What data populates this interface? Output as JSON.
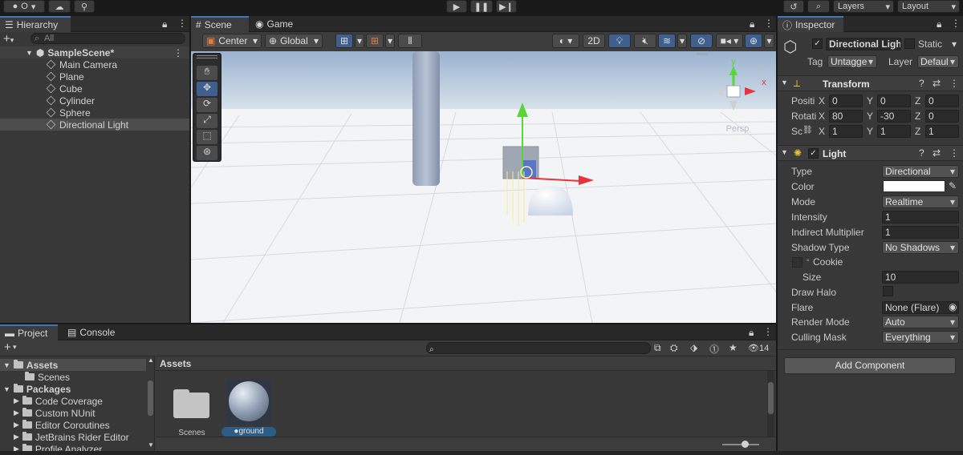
{
  "toolbar": {
    "account_label": "O",
    "play_icon": "play-icon",
    "pause_icon": "pause-icon",
    "step_icon": "step-icon",
    "layers_label": "Layers",
    "layout_label": "Layout"
  },
  "hierarchy": {
    "tab_label": "Hierarchy",
    "search_placeholder": "All",
    "scene_name": "SampleScene*",
    "items": [
      "Main Camera",
      "Plane",
      "Cube",
      "Cylinder",
      "Sphere",
      "Directional Light"
    ],
    "selected_index": 5
  },
  "scene": {
    "tabs": [
      "Scene",
      "Game"
    ],
    "pivot_label": "Center",
    "space_label": "Global",
    "mode_2d_label": "2D",
    "persp_label": "Persp",
    "gizmo_axis_y": "y",
    "gizmo_axis_x": "x"
  },
  "inspector": {
    "tab_label": "Inspector",
    "object_name": "Directional Ligh",
    "static_label": "Static",
    "tag_label": "Tag",
    "tag_value": "Untagge",
    "layer_label": "Layer",
    "layer_value": "Defaul",
    "transform": {
      "title": "Transform",
      "position_label": "Positi",
      "rotation_label": "Rotati",
      "scale_label": "Sc",
      "position": {
        "x": "0",
        "y": "0",
        "z": "0"
      },
      "rotation": {
        "x": "80",
        "y": "-30",
        "z": "0"
      },
      "scale": {
        "x": "1",
        "y": "1",
        "z": "1"
      },
      "axis_x": "X",
      "axis_y": "Y",
      "axis_z": "Z"
    },
    "light": {
      "title": "Light",
      "type_label": "Type",
      "type_value": "Directional",
      "color_label": "Color",
      "color_value": "#ffffff",
      "mode_label": "Mode",
      "mode_value": "Realtime",
      "intensity_label": "Intensity",
      "intensity_value": "1",
      "indirect_label": "Indirect Multiplier",
      "indirect_value": "1",
      "shadow_label": "Shadow Type",
      "shadow_value": "No Shadows",
      "cookie_label": "Cookie",
      "size_label": "Size",
      "size_value": "10",
      "halo_label": "Draw Halo",
      "flare_label": "Flare",
      "flare_value": "None (Flare)",
      "render_label": "Render Mode",
      "render_value": "Auto",
      "culling_label": "Culling Mask",
      "culling_value": "Everything"
    },
    "add_component_label": "Add Component"
  },
  "project": {
    "tabs": [
      "Project",
      "Console"
    ],
    "hidden_count": "14",
    "tree": {
      "assets_label": "Assets",
      "scenes_label": "Scenes",
      "packages_label": "Packages",
      "packages": [
        "Code Coverage",
        "Custom NUnit",
        "Editor Coroutines",
        "JetBrains Rider Editor",
        "Profile Analyzer"
      ]
    },
    "breadcrumb": "Assets",
    "items": [
      "Scenes",
      "ground"
    ]
  },
  "colors": {
    "accent": "#3a79bb",
    "axis_x": "#e8323c",
    "axis_y": "#58d63a",
    "axis_z": "#3a6cd6"
  }
}
